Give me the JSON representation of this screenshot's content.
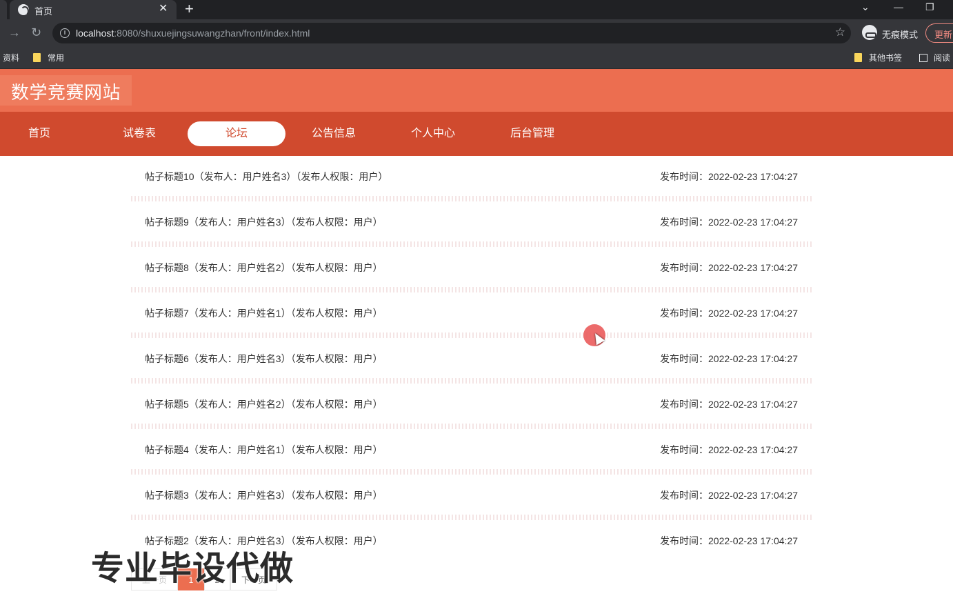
{
  "browser": {
    "tab_title": "首页",
    "url_host": "localhost",
    "url_rest": ":8080/shuxuejingsuwangzhan/front/index.html",
    "incognito_label": "无痕模式",
    "update_label": "更新",
    "bookmarks": {
      "left_partial": "资料",
      "common": "常用",
      "other": "其他书签",
      "reader_partial": "阅读"
    }
  },
  "site": {
    "title": "数学竞赛网站",
    "nav": [
      {
        "label": "首页"
      },
      {
        "label": "试卷表"
      },
      {
        "label": "论坛",
        "active": true
      },
      {
        "label": "公告信息"
      },
      {
        "label": "个人中心"
      },
      {
        "label": "后台管理"
      }
    ]
  },
  "posts": [
    {
      "title": "帖子标题10（发布人：用户姓名3）（发布人权限：用户）",
      "time": "发布时间：2022-02-23 17:04:27"
    },
    {
      "title": "帖子标题9（发布人：用户姓名3）（发布人权限：用户）",
      "time": "发布时间：2022-02-23 17:04:27"
    },
    {
      "title": "帖子标题8（发布人：用户姓名2）（发布人权限：用户）",
      "time": "发布时间：2022-02-23 17:04:27"
    },
    {
      "title": "帖子标题7（发布人：用户姓名1）（发布人权限：用户）",
      "time": "发布时间：2022-02-23 17:04:27"
    },
    {
      "title": "帖子标题6（发布人：用户姓名3）（发布人权限：用户）",
      "time": "发布时间：2022-02-23 17:04:27"
    },
    {
      "title": "帖子标题5（发布人：用户姓名2）（发布人权限：用户）",
      "time": "发布时间：2022-02-23 17:04:27"
    },
    {
      "title": "帖子标题4（发布人：用户姓名1）（发布人权限：用户）",
      "time": "发布时间：2022-02-23 17:04:27"
    },
    {
      "title": "帖子标题3（发布人：用户姓名3）（发布人权限：用户）",
      "time": "发布时间：2022-02-23 17:04:27"
    },
    {
      "title": "帖子标题2（发布人：用户姓名3）（发布人权限：用户）",
      "time": "发布时间：2022-02-23 17:04:27"
    }
  ],
  "pagination": {
    "prev": "上一页",
    "pages": [
      "1",
      "2"
    ],
    "current": "1",
    "next": "下一页"
  },
  "watermark": "专业毕设代做",
  "colors": {
    "header": "#ec6e50",
    "nav": "#d04a2e",
    "accent": "#ec6e50"
  }
}
